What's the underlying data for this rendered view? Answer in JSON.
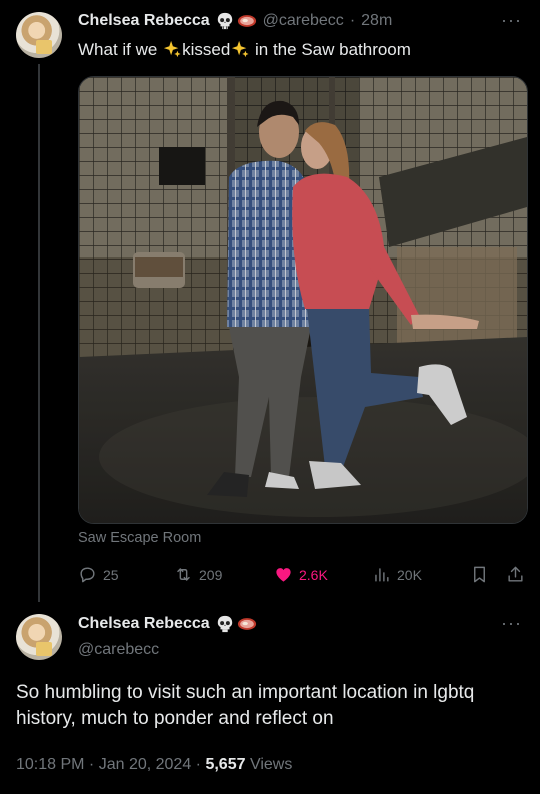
{
  "reply_tweet": {
    "author_name": "Chelsea Rebecca",
    "emoji_names": [
      "skull-emoji",
      "steak-emoji"
    ],
    "handle": "@carebecc",
    "separator": "·",
    "time": "28m",
    "text_before": "What if we ",
    "text_word": "kissed",
    "text_after": " in the Saw bathroom",
    "location_label": "Saw Escape Room",
    "stats": {
      "replies": "25",
      "retweets": "209",
      "likes": "2.6K",
      "views": "20K"
    }
  },
  "main_tweet": {
    "author_name": "Chelsea Rebecca",
    "handle": "@carebecc",
    "text": "So humbling to visit such an important location in lgbtq history, much to ponder and reflect on",
    "timestamp": "10:18 PM · Jan 20, 2024 · ",
    "views_count": "5,657",
    "views_label": " Views"
  },
  "more_label": "···",
  "colors": {
    "background": "#000000",
    "text": "#e7e9ea",
    "secondary": "#71767b",
    "like": "#f91880",
    "divider": "#333639"
  }
}
